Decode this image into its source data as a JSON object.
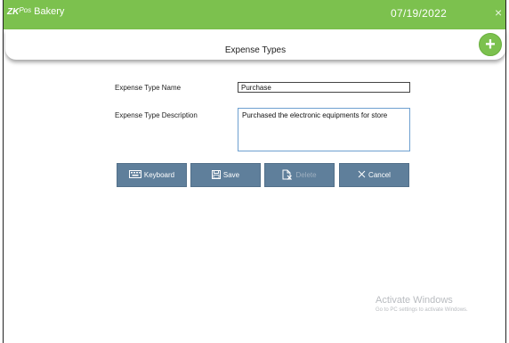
{
  "titlebar": {
    "brand_zk": "ZK",
    "brand_pos": "Pos",
    "brand_name": "Bakery",
    "date": "07/19/2022",
    "close_glyph": "×"
  },
  "header": {
    "title": "Expense Types",
    "add_glyph": "+"
  },
  "form": {
    "name_label": "Expense Type Name",
    "name_value": "Purchase",
    "desc_label": "Expense Type Description",
    "desc_value": "Purchased the electronic equipments for store"
  },
  "buttons": {
    "keyboard": "Keyboard",
    "save": "Save",
    "delete": "Delete",
    "cancel": "Cancel"
  },
  "watermark": {
    "line1": "Activate Windows",
    "line2": "Go to PC settings to activate Windows."
  },
  "colors": {
    "accent": "#7cc14e",
    "button": "#5f7f9b"
  },
  "icons": [
    "keyboard-icon",
    "save-icon",
    "delete-icon",
    "cancel-icon",
    "close-icon",
    "add-icon"
  ]
}
